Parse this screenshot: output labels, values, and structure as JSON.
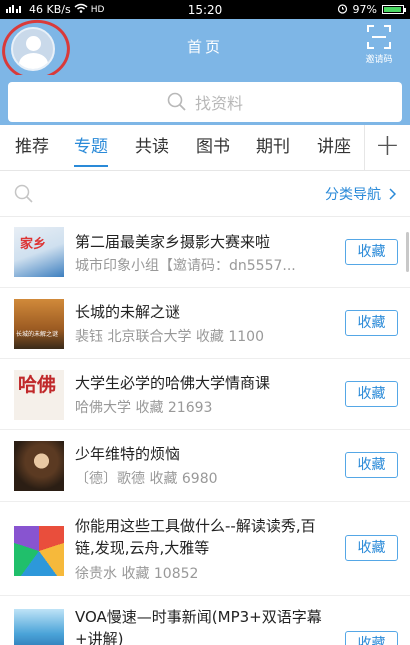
{
  "status_bar": {
    "left": "46 KB/s",
    "time": "15:20",
    "battery": "97%",
    "battery_level": 0.97
  },
  "header": {
    "title": "首页",
    "scan_label": "邀请码"
  },
  "search": {
    "placeholder": "找资料"
  },
  "tabs": [
    {
      "label": "推荐",
      "active": false
    },
    {
      "label": "专题",
      "active": true
    },
    {
      "label": "共读",
      "active": false
    },
    {
      "label": "图书",
      "active": false
    },
    {
      "label": "期刊",
      "active": false
    },
    {
      "label": "讲座",
      "active": false
    }
  ],
  "tab_add_label": "+",
  "category": {
    "nav_label": "分类导航"
  },
  "items": [
    {
      "title": "第二届最美家乡摄影大赛来啦",
      "sub": "城市印象小组【邀请码：dn5557...",
      "button": "收藏",
      "thumb_text": "家乡"
    },
    {
      "title": "长城的未解之谜",
      "sub": "裴钰 北京联合大学   收藏 1100",
      "button": "收藏",
      "thumb_text": "长城的未解之谜"
    },
    {
      "title": "大学生必学的哈佛大学情商课",
      "sub": "哈佛大学   收藏 21693",
      "button": "收藏",
      "thumb_text": "哈佛"
    },
    {
      "title": "少年维特的烦恼",
      "sub": "〔德〕歌德   收藏 6980",
      "button": "收藏",
      "thumb_text": ""
    },
    {
      "title": "你能用这些工具做什么--解读读秀,百链,发现,云舟,大雅等",
      "sub": "徐贵水   收藏 10852",
      "button": "收藏",
      "thumb_text": ""
    },
    {
      "title": "VOA慢速—时事新闻(MP3+双语字幕+讲解)",
      "sub": "",
      "button": "收藏",
      "thumb_text": ""
    }
  ]
}
